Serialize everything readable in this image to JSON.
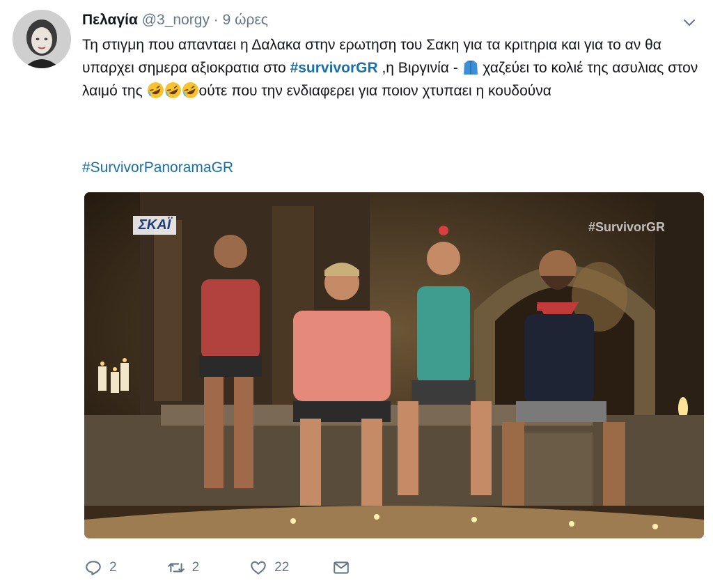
{
  "tweet": {
    "author_name": "Πελαγία",
    "handle": "@3_norgy",
    "separator": "·",
    "time": "9 ώρες",
    "text_1": "Τη στιγμη που απανταει η Δαλακα στην ερωτηση του Σακη για τα κριτηρια και για το αν θα υπαρχει σημερα αξιοκρατια στο ",
    "hashtag_1": "#survivorGR",
    "text_2": " ,η Βιργινία - ",
    "text_3": " χαζεύει το κολιέ της ασυλιας στον λαιμό της ",
    "text_4": "ούτε που την ενδιαφερει για ποιον χτυπαει η κουδούνα",
    "hashtag_2": "#SurvivorPanoramaGR",
    "media_logo": "ΣΚΑΪ",
    "media_watermark": "#SurvivorGR"
  },
  "actions": {
    "reply_count": "2",
    "retweet_count": "2",
    "like_count": "22"
  },
  "icons": [
    "chevron-down-icon",
    "jacket-emoji-icon",
    "rolling-laughing-emoji-icon",
    "reply-icon",
    "retweet-icon",
    "like-icon",
    "direct-message-icon"
  ],
  "colors": {
    "link": "#1b6fa8",
    "secondary": "#657786",
    "text": "#14171a"
  }
}
